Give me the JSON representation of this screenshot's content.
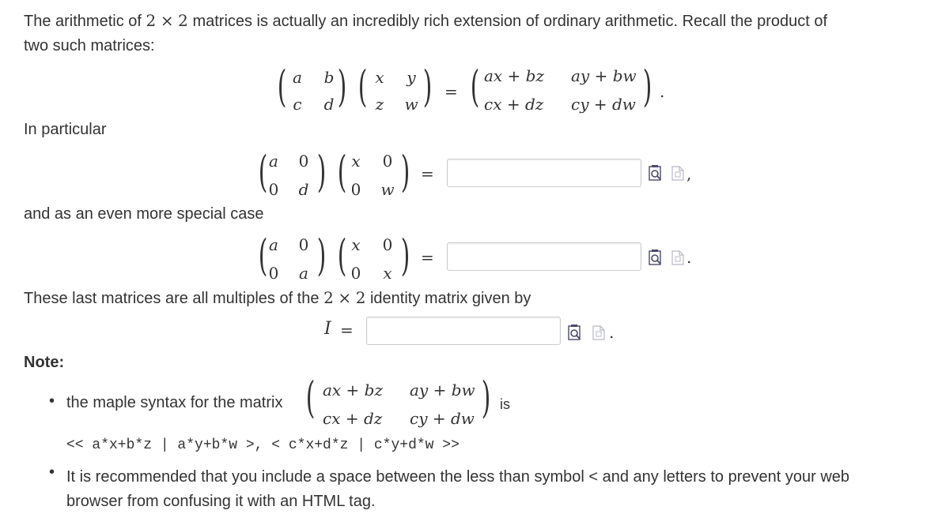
{
  "intro": {
    "part1": "The arithmetic of",
    "dim1": "2",
    "times": "×",
    "dim2": "2",
    "part2": "matrices is actually an incredibly rich extension of ordinary arithmetic. Recall the product of",
    "line2": "two such matrices:"
  },
  "general_product": {
    "A": [
      "a",
      "b",
      "c",
      "d"
    ],
    "B": [
      "x",
      "y",
      "z",
      "w"
    ],
    "equals": "=",
    "C": [
      "ax + bz",
      "ay + bw",
      "cx + dz",
      "cy + dw"
    ],
    "end": "."
  },
  "in_particular": "In particular",
  "diag_product": {
    "A": [
      "a",
      "0",
      "0",
      "d"
    ],
    "B": [
      "x",
      "0",
      "0",
      "w"
    ],
    "equals": "=",
    "answer_value": "",
    "end": ","
  },
  "special_case_text": "and as an even more special case",
  "scalar_product": {
    "A": [
      "a",
      "0",
      "0",
      "a"
    ],
    "B": [
      "x",
      "0",
      "0",
      "x"
    ],
    "equals": "=",
    "answer_value": "",
    "end": "."
  },
  "identity_text": {
    "part1": "These last matrices are all multiples of the",
    "dim1": "2",
    "times": "×",
    "dim2": "2",
    "part2": "identity matrix given by"
  },
  "identity": {
    "label": "I",
    "equals": "=",
    "answer_value": "",
    "end": "."
  },
  "note": {
    "heading": "Note:",
    "bullet1_text": "the maple syntax for the matrix",
    "bullet1_matrix": [
      "ax + bz",
      "ay + bw",
      "cx + dz",
      "cy + dw"
    ],
    "bullet1_is": "is",
    "code": "<< a*x+b*z | a*y+b*w >, < c*x+d*z | c*y+d*w >>",
    "bullet2_line1": "It is recommended that you include a space between the less than symbol < and any letters to prevent your web",
    "bullet2_line2": "browser from confusing it with an HTML tag."
  },
  "icons": {
    "preview": "preview-icon",
    "help": "answer-help-icon"
  },
  "colors": {
    "text": "#333333",
    "border": "#cccccc",
    "icon": "#4a4a6a"
  }
}
